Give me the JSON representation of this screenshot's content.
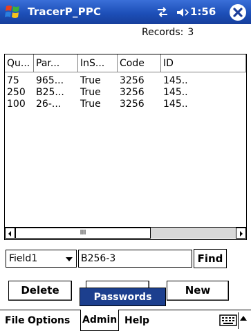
{
  "titlebar": {
    "app_title": "TracerP_PPC",
    "time": "1:56",
    "start_icon": "windows-flag-icon",
    "connectivity_icon": "connectivity-icon",
    "volume_icon": "speaker-icon",
    "close_icon": "close-icon"
  },
  "records": {
    "label": "Records:",
    "count": "3"
  },
  "grid": {
    "columns": [
      "Qu...",
      "Par...",
      "InS...",
      "Code",
      "ID"
    ],
    "rows": [
      [
        "75",
        "965...",
        "True",
        "3256",
        "145.."
      ],
      [
        "250",
        "B25...",
        "True",
        "3256",
        "145.."
      ],
      [
        "100",
        "26-...",
        "True",
        "3256",
        "145.."
      ]
    ],
    "scroll_thumb_glyph": "III"
  },
  "search": {
    "field_value": "Field1",
    "text_value": "B256-3",
    "find_label": "Find"
  },
  "actions": {
    "delete_label": "Delete",
    "new_label": "New"
  },
  "popup": {
    "label": "Passwords"
  },
  "menu": {
    "file": "File",
    "options": "Options",
    "admin": "Admin",
    "help": "Help",
    "keyboard_icon": "keyboard-icon"
  },
  "colors": {
    "titlebar": "#1d4fb8",
    "popup": "#1c3f8e"
  }
}
